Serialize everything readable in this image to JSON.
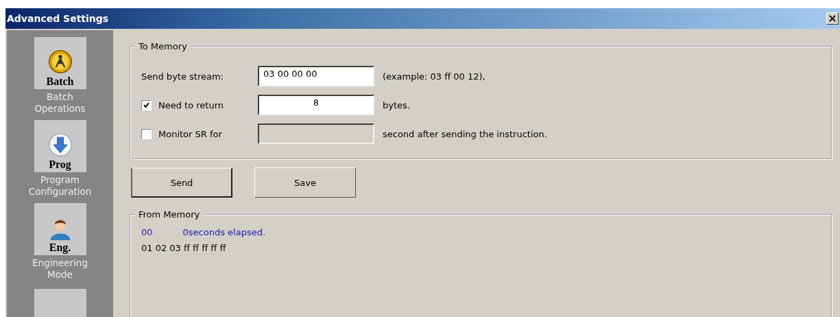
{
  "window": {
    "title": "Advanced Settings",
    "close": "×"
  },
  "sidebar": {
    "items": [
      {
        "kind": "batch",
        "tile_label": "Batch",
        "label": "Batch Operations"
      },
      {
        "kind": "prog",
        "tile_label": "Prog",
        "label": "Program Configuration"
      },
      {
        "kind": "eng",
        "tile_label": "Eng.",
        "label": "Engineering Mode"
      }
    ]
  },
  "to_memory": {
    "title": "To Memory",
    "rows": [
      {
        "kind": "label",
        "label": "Send byte stream:",
        "value": "03 00 00 00",
        "note": "(example: 03 ff 00 12),",
        "disabled": false
      },
      {
        "kind": "checkbox",
        "checked": true,
        "label": "Need to return",
        "value": "8",
        "note": "bytes.",
        "disabled": false
      },
      {
        "kind": "checkbox",
        "checked": false,
        "label": "Monitor SR for",
        "note": "second after sending the instruction.",
        "disabled": true
      }
    ]
  },
  "buttons": [
    {
      "label": "Send",
      "default": true
    },
    {
      "label": "Save",
      "default": false
    }
  ],
  "from_memory": {
    "title": "From Memory",
    "lines": [
      {
        "kind": "status",
        "code": "00",
        "text": "0seconds elapsed."
      },
      {
        "kind": "data",
        "text": "01 02 03 ff ff ff ff ff"
      }
    ]
  }
}
